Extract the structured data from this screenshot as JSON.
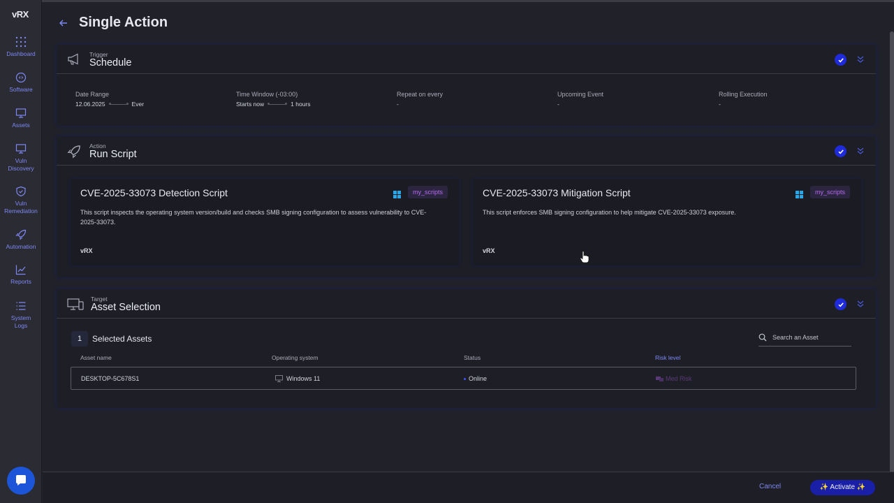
{
  "app": {
    "logo": "vRX"
  },
  "sidebar": {
    "items": [
      {
        "label": "Dashboard",
        "icon": "grid-dots-icon"
      },
      {
        "label": "Software",
        "icon": "software-icon"
      },
      {
        "label": "Assets",
        "icon": "monitor-icon"
      },
      {
        "label": "Vuln Discovery",
        "icon": "vuln-discovery-icon"
      },
      {
        "label": "Vuln Remediation",
        "icon": "shield-icon"
      },
      {
        "label": "Automation",
        "icon": "rocket-icon"
      },
      {
        "label": "Reports",
        "icon": "reports-icon"
      },
      {
        "label": "System Logs",
        "icon": "list-icon"
      }
    ]
  },
  "page": {
    "title": "Single Action"
  },
  "trigger": {
    "small": "Trigger",
    "title": "Schedule",
    "date_range": {
      "label": "Date Range",
      "start": "12.06.2025",
      "end": "Ever"
    },
    "time_window": {
      "label": "Time Window (-03:00)",
      "start": "Starts now",
      "end": "1 hours"
    },
    "repeat": {
      "label": "Repeat on every",
      "value": "-"
    },
    "upcoming": {
      "label": "Upcoming Event",
      "value": "-"
    },
    "rolling": {
      "label": "Rolling Execution",
      "value": "-"
    }
  },
  "action": {
    "small": "Action",
    "title": "Run Script",
    "scripts": [
      {
        "title": "CVE-2025-33073 Detection Script",
        "tag": "my_scripts",
        "description": "This script inspects the operating system version/build and checks SMB signing configuration to assess vulnerability to CVE-2025-33073.",
        "logo": "vRX"
      },
      {
        "title": "CVE-2025-33073 Mitigation Script",
        "tag": "my_scripts",
        "description": "This script enforces SMB signing configuration to help mitigate CVE-2025-33073 exposure.",
        "logo": "vRX"
      }
    ]
  },
  "target": {
    "small": "Target",
    "title": "Asset Selection",
    "count": "1",
    "selected_label": "Selected Assets",
    "search_placeholder": "Search an Asset",
    "columns": [
      "Asset name",
      "Operating system",
      "Status",
      "Risk level"
    ],
    "rows": [
      {
        "name": "DESKTOP-5C678S1",
        "os": "Windows 11",
        "status": "Online",
        "risk": "Med Risk"
      }
    ]
  },
  "footer": {
    "cancel": "Cancel",
    "activate": "✨ Activate ✨"
  },
  "colors": {
    "accent": "#1f2bd8",
    "link": "#7f88f2",
    "tag": "#b56cf0"
  }
}
